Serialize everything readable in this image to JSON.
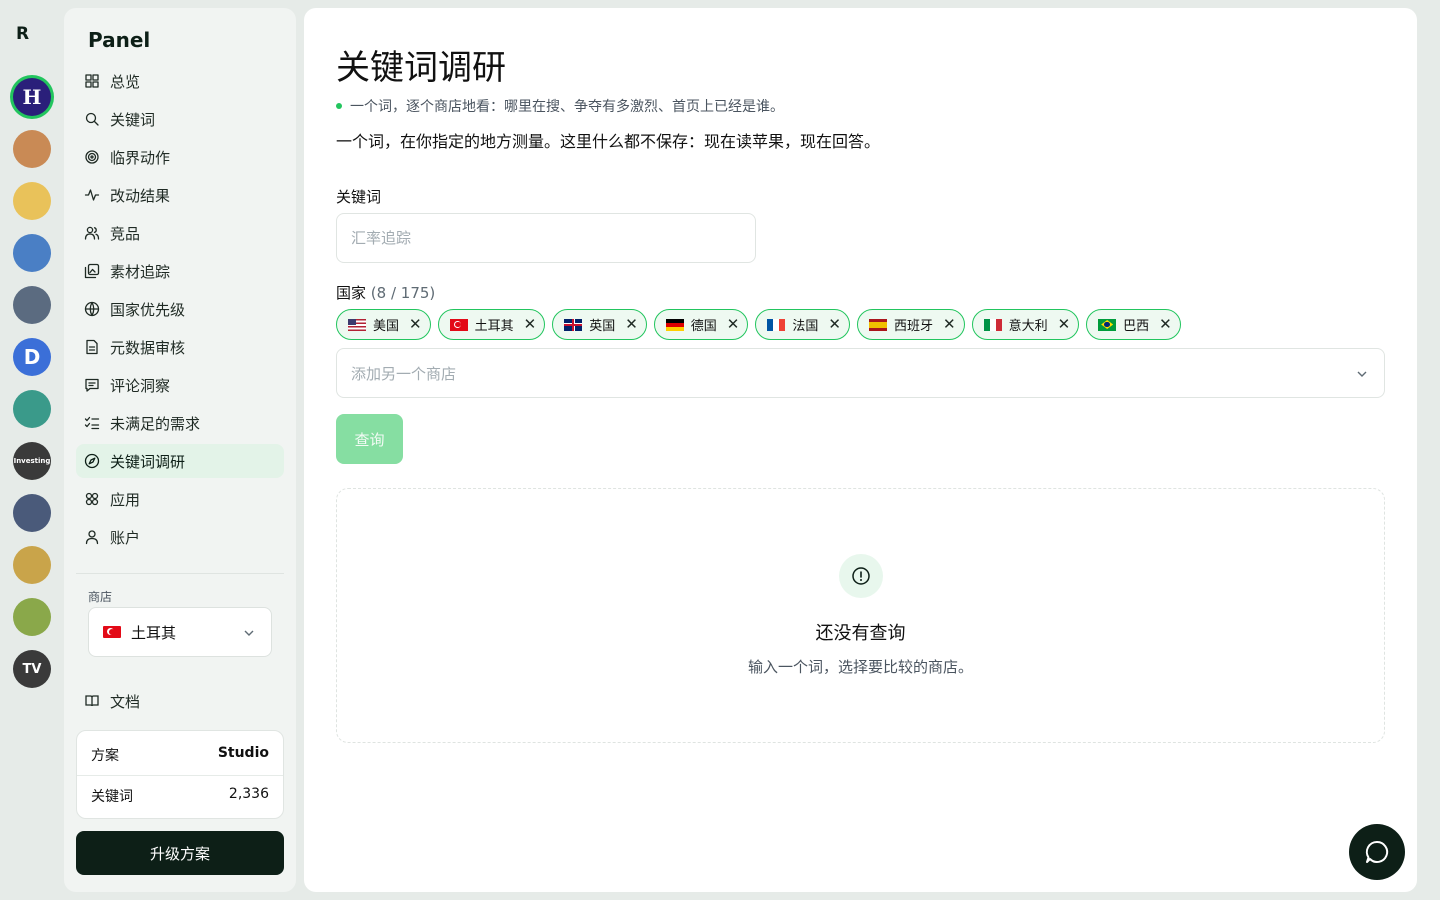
{
  "rail": {
    "logo": "R",
    "apps": [
      {
        "label": "H",
        "bg": "#2a1f7a",
        "fg": "#ffffff",
        "active": true
      },
      {
        "label": "",
        "bg": "#c98a55",
        "fg": "#ffffff"
      },
      {
        "label": "",
        "bg": "#e9c25a",
        "fg": "#ffffff"
      },
      {
        "label": "",
        "bg": "#4a7fc5",
        "fg": "#ffffff"
      },
      {
        "label": "",
        "bg": "#5b6b80",
        "fg": "#ffffff"
      },
      {
        "label": "D",
        "bg": "#3b6fd8",
        "fg": "#ffffff"
      },
      {
        "label": "",
        "bg": "#3a9a8a",
        "fg": "#ffffff"
      },
      {
        "label": "Investing",
        "bg": "#3a3a3a",
        "fg": "#ffffff"
      },
      {
        "label": "",
        "bg": "#4a5a7a",
        "fg": "#ffffff"
      },
      {
        "label": "",
        "bg": "#c9a44a",
        "fg": "#ffffff"
      },
      {
        "label": "",
        "bg": "#8aa84a",
        "fg": "#ffffff"
      },
      {
        "label": "TV",
        "bg": "#3a3a3a",
        "fg": "#ffffff"
      }
    ]
  },
  "sidebar": {
    "brand": "Panel",
    "nav": [
      {
        "label": "总览",
        "icon": "grid-icon"
      },
      {
        "label": "关键词",
        "icon": "search-icon"
      },
      {
        "label": "临界动作",
        "icon": "target-icon"
      },
      {
        "label": "改动结果",
        "icon": "activity-icon"
      },
      {
        "label": "竞品",
        "icon": "users-icon"
      },
      {
        "label": "素材追踪",
        "icon": "images-icon"
      },
      {
        "label": "国家优先级",
        "icon": "globe-icon"
      },
      {
        "label": "元数据审核",
        "icon": "file-icon"
      },
      {
        "label": "评论洞察",
        "icon": "message-icon"
      },
      {
        "label": "未满足的需求",
        "icon": "list-check-icon"
      },
      {
        "label": "关键词调研",
        "icon": "compass-icon",
        "active": true
      },
      {
        "label": "应用",
        "icon": "apps-icon"
      },
      {
        "label": "账户",
        "icon": "user-icon"
      }
    ],
    "store": {
      "label": "商店",
      "value": "土耳其"
    },
    "docs": "文档",
    "plan": {
      "plan_label": "方案",
      "plan_value": "Studio",
      "kw_label": "关键词",
      "kw_value": "2,336"
    },
    "upgrade": "升级方案"
  },
  "main": {
    "title": "关键词调研",
    "tagline": "一个词，逐个商店地看：哪里在搜、争夺有多激烈、首页上已经是谁。",
    "description": "一个词，在你指定的地方测量。这里什么都不保存：现在读苹果，现在回答。",
    "keyword_label": "关键词",
    "keyword_placeholder": "汇率追踪",
    "keyword_value": "",
    "country_label": "国家",
    "country_count": "(8 / 175)",
    "countries": [
      "美国",
      "土耳其",
      "英国",
      "德国",
      "法国",
      "西班牙",
      "意大利",
      "巴西"
    ],
    "add_store_placeholder": "添加另一个商店",
    "query_button": "查询",
    "empty_title": "还没有查询",
    "empty_subtitle": "输入一个词，选择要比较的商店。"
  },
  "colors": {
    "accent": "#22c55e",
    "dark": "#0d1f17",
    "chip_bg": "#eef9f1",
    "query_disabled": "#86dea2"
  }
}
